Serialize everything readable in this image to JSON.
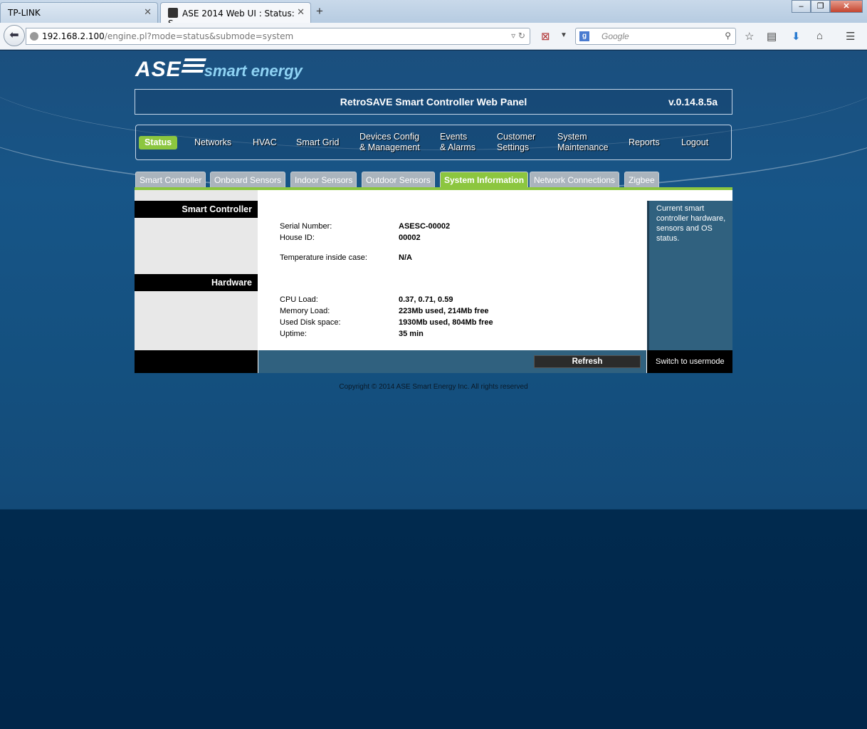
{
  "browser": {
    "tabs": [
      {
        "label": "TP-LINK"
      },
      {
        "label": "ASE 2014 Web UI : Status: S..."
      }
    ],
    "url_host": "192.168.2.100",
    "url_path": "/engine.pl?mode=status&submode=system",
    "search_placeholder": "Google"
  },
  "header": {
    "logo_ase": "ASE",
    "logo_tagline": "smart energy",
    "panel_title": "RetroSAVE Smart Controller Web Panel",
    "version": "v.0.14.8.5a"
  },
  "mainnav": [
    {
      "line1": "Status",
      "line2": ""
    },
    {
      "line1": "Networks",
      "line2": ""
    },
    {
      "line1": "HVAC",
      "line2": ""
    },
    {
      "line1": "Smart Grid",
      "line2": ""
    },
    {
      "line1": "Devices Config",
      "line2": "& Management"
    },
    {
      "line1": "Events",
      "line2": "& Alarms"
    },
    {
      "line1": "Customer",
      "line2": "Settings"
    },
    {
      "line1": "System",
      "line2": "Maintenance"
    },
    {
      "line1": "Reports",
      "line2": ""
    },
    {
      "line1": "Logout",
      "line2": ""
    }
  ],
  "subtabs": [
    "Smart Controller",
    "Onboard Sensors",
    "Indoor Sensors",
    "Outdoor Sensors",
    "System Information",
    "Network Connections",
    "Zigbee"
  ],
  "sidebar": {
    "section1": "Smart Controller",
    "section2": "Hardware"
  },
  "info": {
    "serial_label": "Serial Number:",
    "serial_value": "ASESC-00002",
    "house_label": "House ID:",
    "house_value": "00002",
    "temp_label": "Temperature inside case:",
    "temp_value": "N/A",
    "cpu_label": "CPU Load:",
    "cpu_value": "0.37, 0.71, 0.59",
    "mem_label": "Memory Load:",
    "mem_value": "223Mb used, 214Mb free",
    "disk_label": "Used Disk space:",
    "disk_value": "1930Mb used, 804Mb free",
    "uptime_label": "Uptime:",
    "uptime_value": "35 min"
  },
  "help": {
    "text": "Current smart controller hardware, sensors and OS status."
  },
  "actions": {
    "refresh": "Refresh",
    "usermode": "Switch to usermode"
  },
  "footer": {
    "copyright": "Copyright © 2014 ASE Smart Energy Inc. All rights reserved"
  },
  "colors": {
    "accent_green": "#8cc63f",
    "panel_blue": "#30617f"
  }
}
